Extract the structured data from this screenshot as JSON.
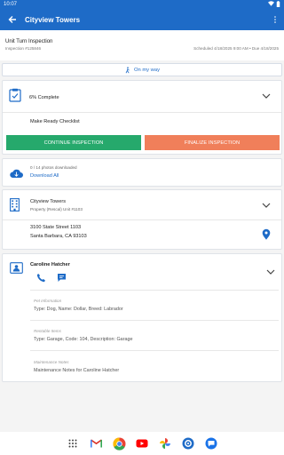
{
  "status_bar": {
    "time": "10:07"
  },
  "app_bar": {
    "title": "Cityview Towers"
  },
  "inspection": {
    "title": "Unit Turn Inspection",
    "number": "Inspection #125846",
    "scheduled": "Scheduled 4/18/2025 9:00 AM • Due 4/18/2025"
  },
  "on_my_way": {
    "label": "On my way"
  },
  "progress": {
    "percent_label": "6% Complete",
    "percent_value": 6,
    "checklist": "Make Ready Checklist",
    "continue_button": "CONTINUE INSPECTION",
    "finalize_button": "FINALIZE INSPECTION"
  },
  "photos": {
    "status": "0 / 14 photos downloaded",
    "download_all": "Download All"
  },
  "property": {
    "name": "Cityview Towers",
    "unit": "Property (Rescal) Unit #1103",
    "address1": "3100 State Street 1103",
    "address2": "Santa Barbara, CA 93103"
  },
  "contact": {
    "name": "Caroline Hatcher",
    "pet_label": "Pet Information",
    "pet_value": "Type: Dog, Name: Dollar, Breed: Labrador",
    "rentable_label": "Rentable Items",
    "rentable_value": "Type: Garage, Code: 104, Description: Garage",
    "notes_label": "Maintenance Notes",
    "notes_value": "Maintenance Notes for Caroline Hatcher"
  },
  "icons": {
    "primary": "#1e6bc7",
    "green": "#26a96c",
    "orange": "#f07f5a"
  }
}
